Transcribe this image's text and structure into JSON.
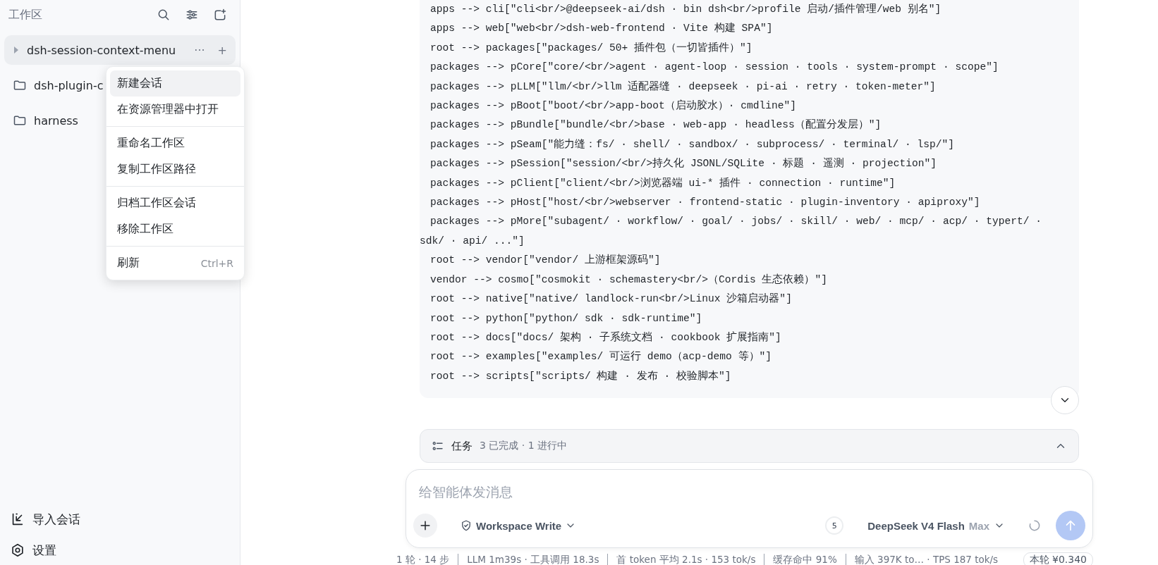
{
  "sidebar": {
    "title": "工作区",
    "workspaces": [
      {
        "name": "dsh-session-context-menu",
        "selected": true,
        "actions": [
          "···",
          "+"
        ]
      },
      {
        "name": "dsh-plugin-c",
        "selected": false
      },
      {
        "name": "harness",
        "selected": false
      }
    ],
    "context_menu": {
      "groups": [
        [
          {
            "label": "新建会话",
            "selected": true
          },
          {
            "label": "在资源管理器中打开",
            "selected": false
          }
        ],
        [
          {
            "label": "重命名工作区",
            "selected": false
          },
          {
            "label": "复制工作区路径",
            "selected": false
          }
        ],
        [
          {
            "label": "归档工作区会话",
            "selected": false
          },
          {
            "label": "移除工作区",
            "selected": false
          }
        ],
        [
          {
            "label": "刷新",
            "selected": false,
            "shortcut": "Ctrl+R"
          }
        ]
      ]
    },
    "footer": [
      {
        "kind": "import",
        "label": "导入会话"
      },
      {
        "kind": "settings",
        "label": "设置"
      }
    ]
  },
  "code_lines": [
    "apps --> cli[\"cli<br/>@deepseek-ai/dsh · bin dsh<br/>profile 启动/插件管理/web 别名\"]",
    "apps --> web[\"web<br/>dsh-web-frontend · Vite 构建 SPA\"]",
    "root --> packages[\"packages/ 50+ 插件包（一切皆插件）\"]",
    "packages --> pCore[\"core/<br/>agent · agent-loop · session · tools · system-prompt · scope\"]",
    "packages --> pLLM[\"llm/<br/>llm 适配器缝 · deepseek · pi-ai · retry · token-meter\"]",
    "packages --> pBoot[\"boot/<br/>app-boot（启动胶水）· cmdline\"]",
    "packages --> pBundle[\"bundle/<br/>base · web-app · headless（配置分发层）\"]",
    "packages --> pSeam[\"能力缝：fs/ · shell/ · sandbox/ · subprocess/ · terminal/ · lsp/\"]",
    "packages --> pSession[\"session/<br/>持久化 JSONL/SQLite · 标题 · 遥测 · projection\"]",
    "packages --> pClient[\"client/<br/>浏览器端 ui-* 插件 · connection · runtime\"]",
    "packages --> pHost[\"host/<br/>webserver · frontend-static · plugin-inventory · apiproxy\"]",
    "packages --> pMore[\"subagent/ · workflow/ · goal/ · jobs/ · skill/ · web/ · mcp/ · acp/ · typert/ · sdk/ · api/ ...\"]",
    "root --> vendor[\"vendor/ 上游框架源码\"]",
    "vendor --> cosmo[\"cosmokit · schemastery<br/>（Cordis 生态依赖）\"]",
    "root --> native[\"native/ landlock-run<br/>Linux 沙箱启动器\"]",
    "root --> python[\"python/ sdk · sdk-runtime\"]",
    "root --> docs[\"docs/ 架构 · 子系统文档 · cookbook 扩展指南\"]",
    "root --> examples[\"examples/ 可运行 demo（acp-demo 等）\"]",
    "root --> scripts[\"scripts/ 构建 · 发布 · 校验脚本\"]"
  ],
  "tasks": {
    "label": "任务",
    "summary": "3 已完成 · 1 进行中",
    "expanded": true
  },
  "composer": {
    "placeholder": "给智能体发消息",
    "mode": "Workspace Write",
    "count": "5",
    "model": "DeepSeek V4 Flash",
    "effort": "Max",
    "send_disabled": true
  },
  "status_bar": {
    "items": [
      "1 轮 · 14 步",
      "LLM 1m39s · 工具调用 18.3s",
      "首 token 平均 2.1s · 153 tok/s",
      "缓存命中 91%",
      "输入 397K to… · TPS 187 tok/s"
    ],
    "cost": "本轮 ¥0.340"
  }
}
